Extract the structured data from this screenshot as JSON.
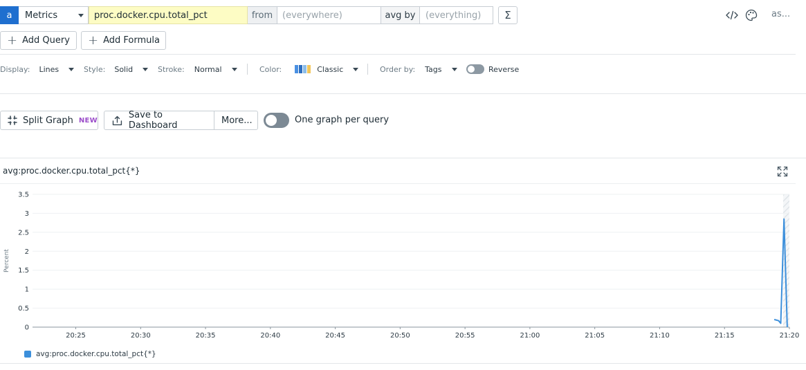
{
  "query": {
    "letter": "a",
    "source": "Metrics",
    "metric": "proc.docker.cpu.total_pct",
    "from_label": "from",
    "from_placeholder": "(everywhere)",
    "avg_label": "avg by",
    "avg_placeholder": "(everything)",
    "sigma": "Σ",
    "truncated_text": "as..."
  },
  "add_buttons": {
    "add_query": "Add Query",
    "add_formula": "Add Formula"
  },
  "display": {
    "display_label": "Display:",
    "display_value": "Lines",
    "style_label": "Style:",
    "style_value": "Solid",
    "stroke_label": "Stroke:",
    "stroke_value": "Normal",
    "color_label": "Color:",
    "color_value": "Classic",
    "palette": [
      "#4a90e2",
      "#2f6fbf",
      "#8cbde8",
      "#f2c65b"
    ],
    "order_label": "Order by:",
    "order_value": "Tags",
    "reverse_label": "Reverse"
  },
  "actions": {
    "split_graph": "Split Graph",
    "new_badge": "NEW",
    "save_dashboard": "Save to Dashboard",
    "more": "More...",
    "one_graph_label": "One graph per query"
  },
  "graph": {
    "title": "avg:proc.docker.cpu.total_pct{*}",
    "legend_label": "avg:proc.docker.cpu.total_pct{*}",
    "line_color": "#3c8fdb"
  },
  "chart_data": {
    "type": "line",
    "title": "avg:proc.docker.cpu.total_pct{*}",
    "xlabel": "",
    "ylabel": "Percent",
    "ylim": [
      0,
      3.5
    ],
    "y_ticks": [
      "0",
      "0.5",
      "1",
      "1.5",
      "2",
      "2.5",
      "3",
      "3.5"
    ],
    "x_ticks": [
      "20:25",
      "20:30",
      "20:35",
      "20:40",
      "20:45",
      "20:50",
      "20:55",
      "21:00",
      "21:05",
      "21:10",
      "21:15",
      "21:20"
    ],
    "x_range": [
      "20:21:40",
      "21:20:00"
    ],
    "grid": true,
    "legend": "bottom-left",
    "series": [
      {
        "name": "avg:proc.docker.cpu.total_pct{*}",
        "x": [
          "21:18:50",
          "21:19:10",
          "21:19:20",
          "21:19:35",
          "21:19:50"
        ],
        "values": [
          0.2,
          0.17,
          0.1,
          2.85,
          0.0
        ]
      }
    ]
  }
}
